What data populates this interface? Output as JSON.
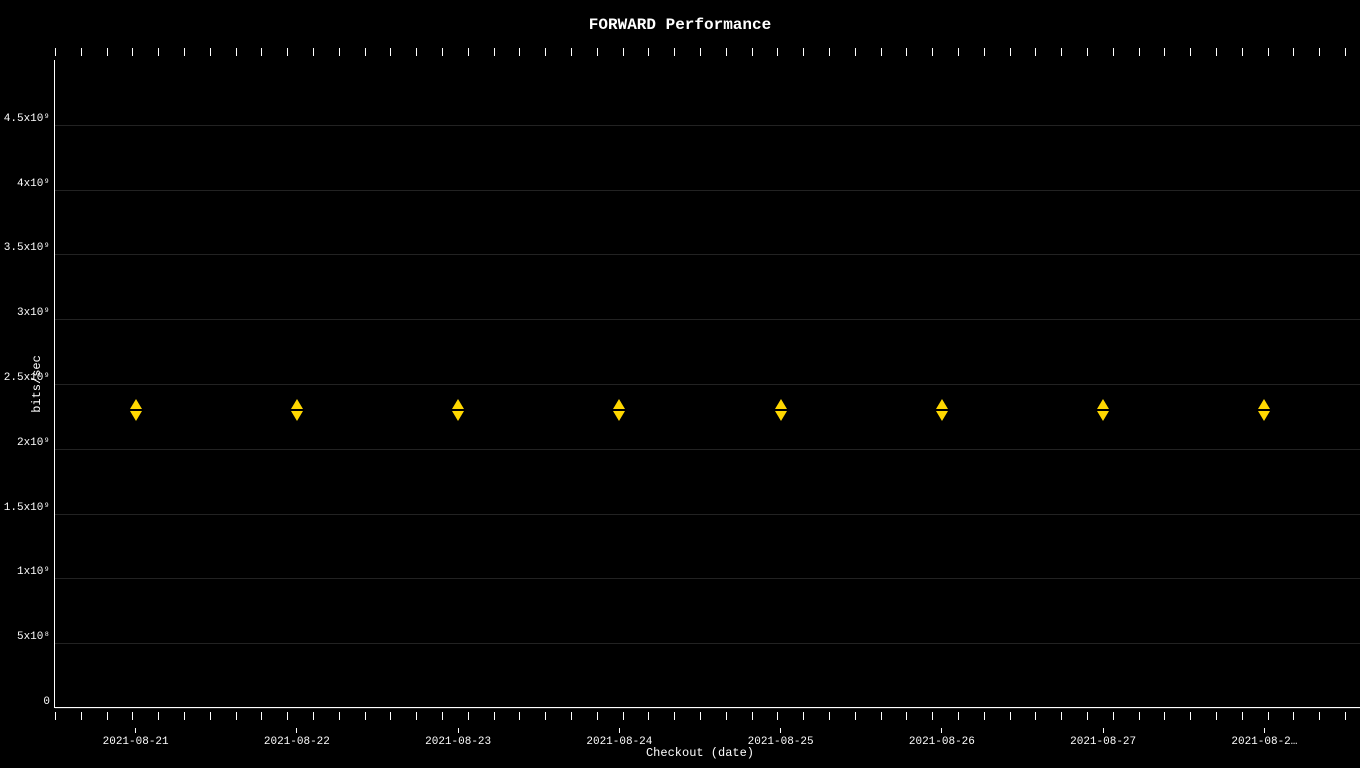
{
  "chart": {
    "title": "FORWARD Performance",
    "x_axis_label": "Checkout (date)",
    "y_axis_label": "bits/sec",
    "y_ticks": [
      {
        "value": "4.5x10⁹",
        "percent": 90
      },
      {
        "value": "4x10⁹",
        "percent": 80
      },
      {
        "value": "3.5x10⁹",
        "percent": 70
      },
      {
        "value": "3x10⁹",
        "percent": 60
      },
      {
        "value": "2.5x10⁹",
        "percent": 50
      },
      {
        "value": "2x10⁹",
        "percent": 40
      },
      {
        "value": "1.5x10⁹",
        "percent": 30
      },
      {
        "value": "1x10⁹",
        "percent": 20
      },
      {
        "value": "5x10⁸",
        "percent": 10
      },
      {
        "value": "0",
        "percent": 0
      }
    ],
    "x_ticks": [
      {
        "label": "2021-08-21",
        "percent": 6.25
      },
      {
        "label": "2021-08-22",
        "percent": 18.75
      },
      {
        "label": "2021-08-23",
        "percent": 31.25
      },
      {
        "label": "2021-08-24",
        "percent": 43.75
      },
      {
        "label": "2021-08-25",
        "percent": 56.25
      },
      {
        "label": "2021-08-26",
        "percent": 68.75
      },
      {
        "label": "2021-08-27",
        "percent": 81.25
      },
      {
        "label": "2021-08-2…",
        "percent": 93.75
      }
    ],
    "data_points": [
      {
        "x_percent": 6.25,
        "y_percent": 46
      },
      {
        "x_percent": 18.75,
        "y_percent": 46
      },
      {
        "x_percent": 31.25,
        "y_percent": 46
      },
      {
        "x_percent": 43.75,
        "y_percent": 46
      },
      {
        "x_percent": 56.25,
        "y_percent": 46
      },
      {
        "x_percent": 68.75,
        "y_percent": 46
      },
      {
        "x_percent": 81.25,
        "y_percent": 46
      },
      {
        "x_percent": 93.75,
        "y_percent": 46
      }
    ]
  }
}
